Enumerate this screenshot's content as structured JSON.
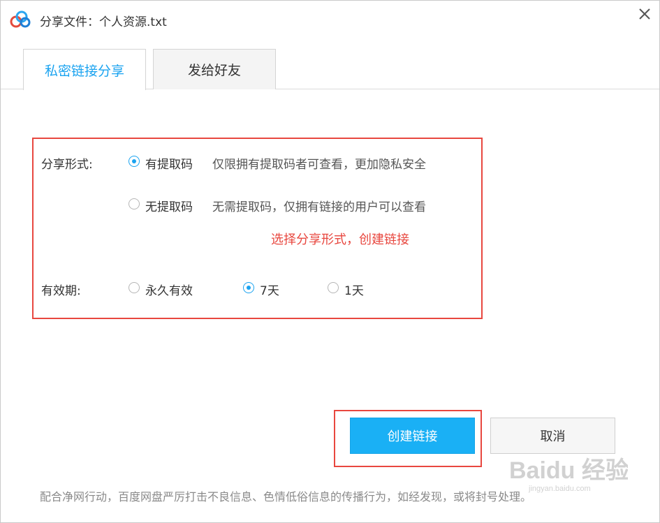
{
  "window": {
    "title": "分享文件：个人资源.txt",
    "app_icon": "baidu-netdisk-cloud-icon",
    "close_icon": "close-icon"
  },
  "tabs": [
    {
      "label": "私密链接分享",
      "active": true
    },
    {
      "label": "发给好友",
      "active": false
    }
  ],
  "share_form": {
    "label": "分享形式:",
    "options": [
      {
        "label": "有提取码",
        "desc": "仅限拥有提取码者可查看，更加隐私安全",
        "checked": true
      },
      {
        "label": "无提取码",
        "desc": "无需提取码，仅拥有链接的用户可以查看",
        "checked": false
      }
    ],
    "annotation": "选择分享形式，创建链接"
  },
  "validity": {
    "label": "有效期:",
    "options": [
      {
        "label": "永久有效",
        "checked": false
      },
      {
        "label": "7天",
        "checked": true
      },
      {
        "label": "1天",
        "checked": false
      }
    ]
  },
  "buttons": {
    "create": "创建链接",
    "cancel": "取消"
  },
  "footer": {
    "note": "配合净网行动，百度网盘严厉打击不良信息、色情低俗信息的传播行为，如经发现，或将封号处理。"
  },
  "watermark": {
    "text": "Baidu 经验",
    "sub": "jingyan.baidu.com"
  },
  "colors": {
    "accent": "#1aa3f0",
    "primary_button": "#1ab0f5",
    "annotation_red": "#e8473f"
  }
}
